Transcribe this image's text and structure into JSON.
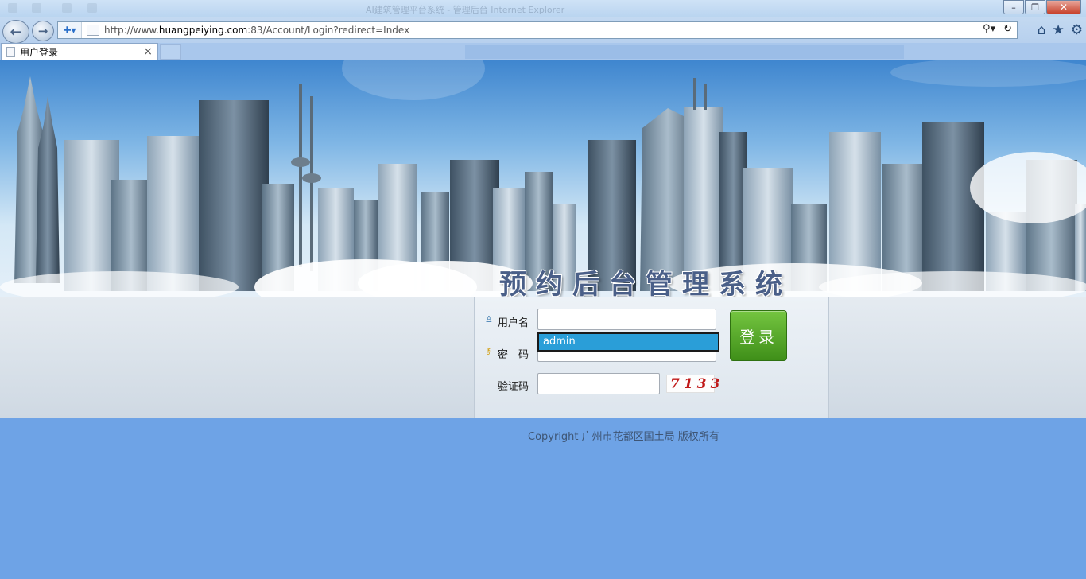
{
  "window": {
    "title": "AI建筑管理平台系统 - 管理后台 Internet Explorer",
    "buttons": {
      "minimize": "–",
      "restore": "❐",
      "close": "✕"
    }
  },
  "browser": {
    "url_prefix": "http://www.",
    "url_domain": "huangpeiying.com",
    "url_suffix": ":83/Account/Login?redirect=Index",
    "tab_title": "用户登录",
    "tab_close": "×"
  },
  "banner": {
    "title": "预约后台管理系统"
  },
  "login": {
    "username_label": "用户名",
    "password_label": "密　码",
    "captcha_label": "验证码",
    "username_value": "",
    "password_value": "",
    "captcha_value": "",
    "autocomplete_suggestion": "admin",
    "login_button": "登录",
    "captcha_image_text": "7133"
  },
  "footer": {
    "copyright": "Copyright 广州市花都区国土局 版权所有"
  },
  "colors": {
    "page_bg": "#6ea3e6",
    "login_button": "#4f9f24",
    "autocomplete_highlight": "#2a9ed8",
    "captcha_text": "#c01818"
  },
  "icons": [
    "back-arrow-icon",
    "forward-arrow-icon",
    "security-shield-icon",
    "page-icon",
    "search-icon",
    "refresh-icon",
    "home-icon",
    "favorites-star-icon",
    "settings-gear-icon",
    "user-icon",
    "key-icon"
  ]
}
